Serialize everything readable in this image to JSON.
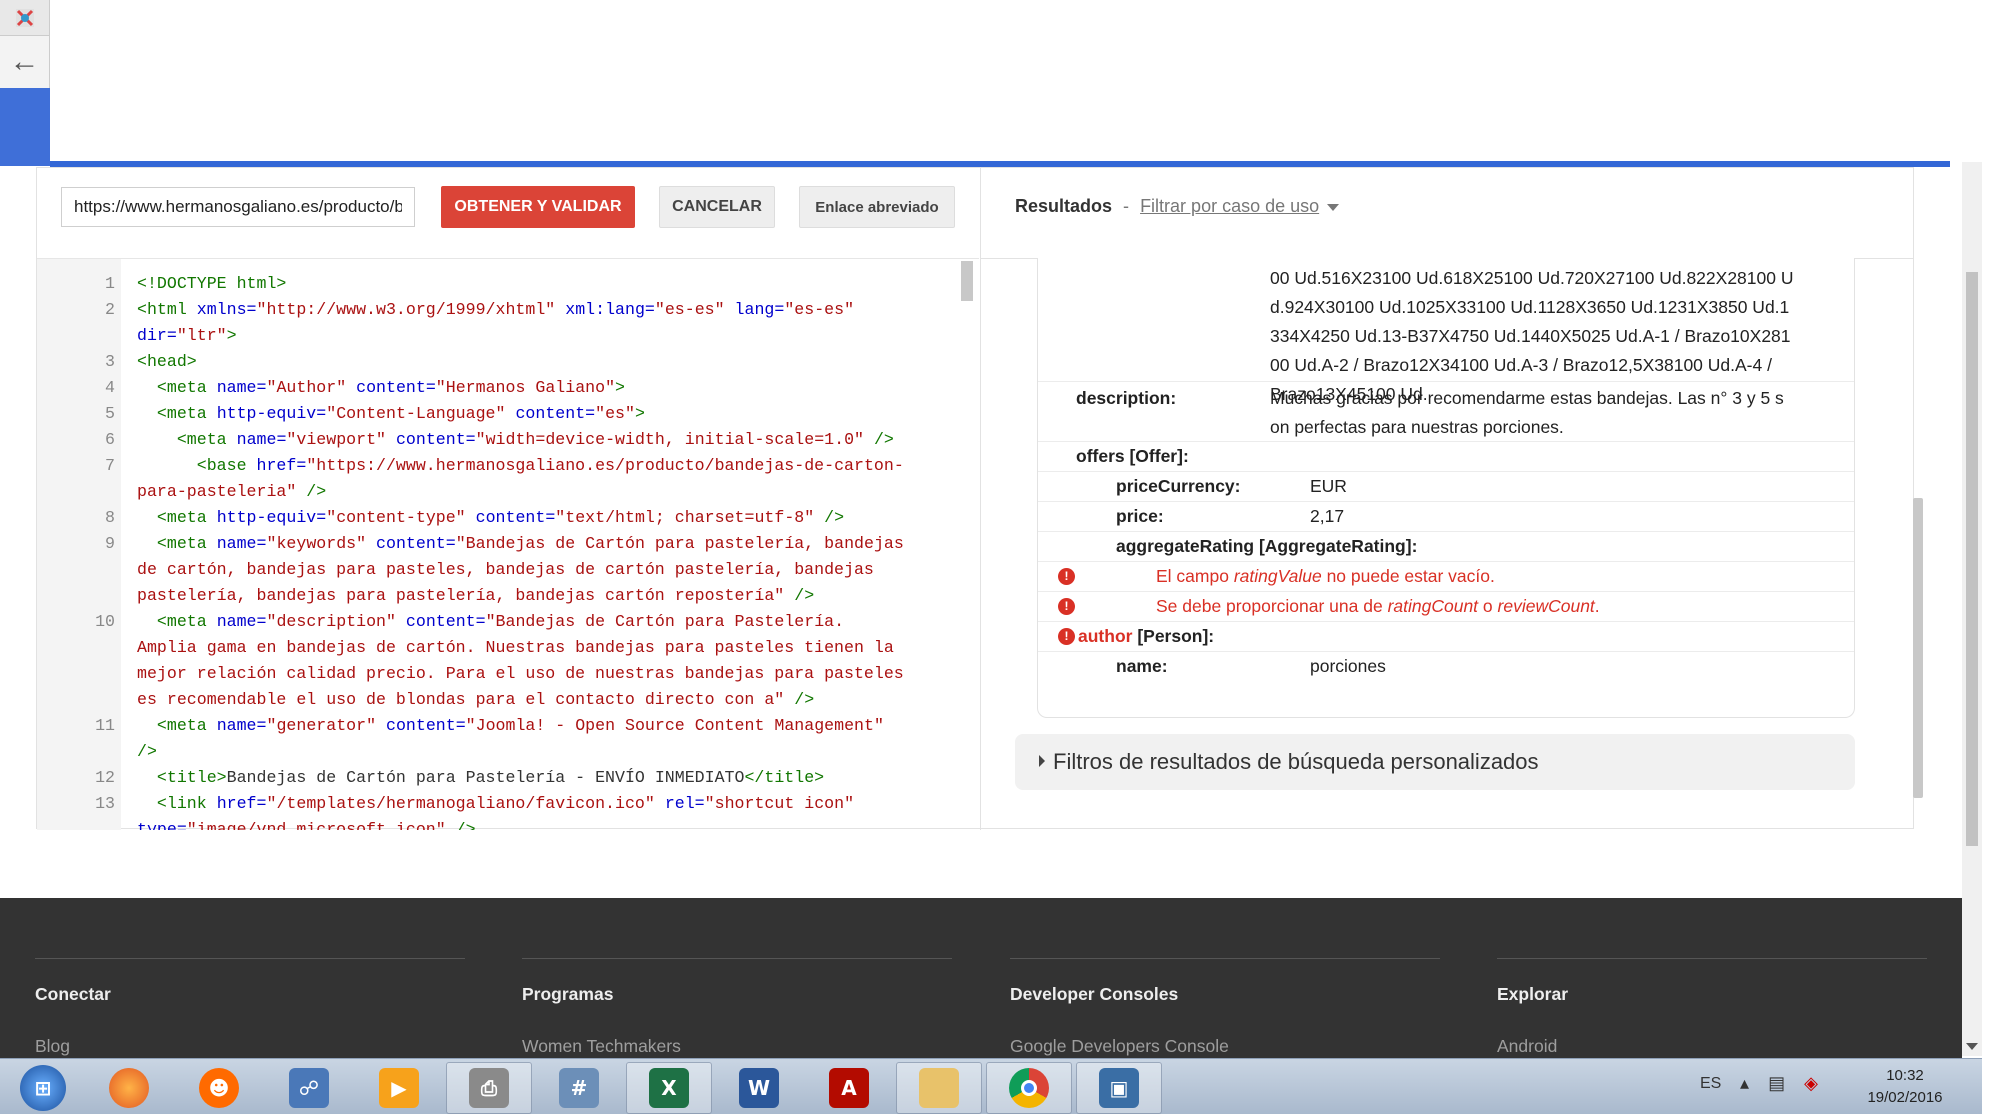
{
  "browser": {
    "back_icon": "arrow-left-icon"
  },
  "toolbar": {
    "url_value": "https://www.hermanosgaliano.es/producto/bandejas-de-carton-para-pasteleria",
    "fetch_label": "OBTENER Y VALIDAR",
    "cancel_label": "CANCELAR",
    "shortlink_label": "Enlace abreviado"
  },
  "editor": {
    "lines": [
      {
        "n": "1",
        "html": "<span class=\"tag\">&lt;!DOCTYPE html&gt;</span>"
      },
      {
        "n": "2",
        "html": "<span class=\"tag\">&lt;html</span> <span class=\"att\">xmlns=</span><span class=\"str\">\"http://www.w3.org/1999/xhtml\"</span> <span class=\"att\">xml:lang=</span><span class=\"str\">\"es-es\"</span> <span class=\"att\">lang=</span><span class=\"str\">\"es-es\"</span>"
      },
      {
        "n": "",
        "html": "<span class=\"att\">dir=</span><span class=\"str\">\"ltr\"</span><span class=\"tag\">&gt;</span>"
      },
      {
        "n": "3",
        "html": "<span class=\"tag\">&lt;head&gt;</span>"
      },
      {
        "n": "4",
        "html": "  <span class=\"tag\">&lt;meta</span> <span class=\"att\">name=</span><span class=\"str\">\"Author\"</span> <span class=\"att\">content=</span><span class=\"str\">\"Hermanos Galiano\"</span><span class=\"tag\">&gt;</span>"
      },
      {
        "n": "5",
        "html": "  <span class=\"tag\">&lt;meta</span> <span class=\"att\">http-equiv=</span><span class=\"str\">\"Content-Language\"</span> <span class=\"att\">content=</span><span class=\"str\">\"es\"</span><span class=\"tag\">&gt;</span>"
      },
      {
        "n": "6",
        "html": "    <span class=\"tag\">&lt;meta</span> <span class=\"att\">name=</span><span class=\"str\">\"viewport\"</span> <span class=\"att\">content=</span><span class=\"str\">\"width=device-width, initial-scale=1.0\"</span> <span class=\"tag\">/&gt;</span>"
      },
      {
        "n": "7",
        "html": "      <span class=\"tag\">&lt;base</span> <span class=\"att\">href=</span><span class=\"str\">\"https://www.hermanosgaliano.es/producto/bandejas-de-carton-</span>"
      },
      {
        "n": "",
        "html": "<span class=\"str\">para-pasteleria\"</span> <span class=\"tag\">/&gt;</span>"
      },
      {
        "n": "8",
        "html": "  <span class=\"tag\">&lt;meta</span> <span class=\"att\">http-equiv=</span><span class=\"str\">\"content-type\"</span> <span class=\"att\">content=</span><span class=\"str\">\"text/html; charset=utf-8\"</span> <span class=\"tag\">/&gt;</span>"
      },
      {
        "n": "9",
        "html": "  <span class=\"tag\">&lt;meta</span> <span class=\"att\">name=</span><span class=\"str\">\"keywords\"</span> <span class=\"att\">content=</span><span class=\"str\">\"Bandejas de Cartón para pastelería, bandejas</span>"
      },
      {
        "n": "",
        "html": "<span class=\"str\">de cartón, bandejas para pasteles, bandejas de cartón pastelería, bandejas</span>"
      },
      {
        "n": "",
        "html": "<span class=\"str\">pastelería, bandejas para pastelería, bandejas cartón repostería\"</span> <span class=\"tag\">/&gt;</span>"
      },
      {
        "n": "10",
        "html": "  <span class=\"tag\">&lt;meta</span> <span class=\"att\">name=</span><span class=\"str\">\"description\"</span> <span class=\"att\">content=</span><span class=\"str\">\"Bandejas de Cartón para Pastelería.</span>"
      },
      {
        "n": "",
        "html": "<span class=\"str\">Amplia gama en bandejas de cartón. Nuestras bandejas para pasteles tienen la</span>"
      },
      {
        "n": "",
        "html": "<span class=\"str\">mejor relación calidad precio. Para el uso de nuestras bandejas para pasteles</span>"
      },
      {
        "n": "",
        "html": "<span class=\"str\">es recomendable el uso de blondas para el contacto directo con a\"</span> <span class=\"tag\">/&gt;</span>"
      },
      {
        "n": "11",
        "html": "  <span class=\"tag\">&lt;meta</span> <span class=\"att\">name=</span><span class=\"str\">\"generator\"</span> <span class=\"att\">content=</span><span class=\"str\">\"Joomla! - Open Source Content Management\"</span>"
      },
      {
        "n": "",
        "html": "<span class=\"tag\">/&gt;</span>"
      },
      {
        "n": "12",
        "html": "  <span class=\"tag\">&lt;title&gt;</span>Bandejas de Cartón para Pastelería - ENVÍO INMEDIATO<span class=\"tag\">&lt;/title&gt;</span>"
      },
      {
        "n": "13",
        "html": "  <span class=\"tag\">&lt;link</span> <span class=\"att\">href=</span><span class=\"str\">\"/templates/hermanogaliano/favicon.ico\"</span> <span class=\"att\">rel=</span><span class=\"str\">\"shortcut icon\"</span>"
      },
      {
        "n": "",
        "html": "<span class=\"att\">type=</span><span class=\"str\">\"image/vnd.microsoft.icon\"</span> <span class=\"tag\">/&gt;</span>"
      }
    ]
  },
  "results": {
    "title": "Resultados",
    "separator": "-",
    "filter_label": "Filtrar por caso de uso",
    "name_lines": [
      "00 Ud.516X23100 Ud.618X25100 Ud.720X27100 Ud.822X28100 U",
      "d.924X30100 Ud.1025X33100 Ud.1128X3650 Ud.1231X3850 Ud.1",
      "334X4250 Ud.13-B37X4750 Ud.1440X5025 Ud.A-1 / Brazo10X281",
      "00 Ud.A-2 / Brazo12X34100 Ud.A-3 / Brazo12,5X38100 Ud.A-4 /",
      "Brazo13X45100 Ud."
    ],
    "description_key": "description:",
    "description_lines": [
      "Muchas gracias por recomendarme estas bandejas. Las n° 3 y 5 s",
      "on perfectas para nuestras porciones."
    ],
    "offers_key": "offers [Offer]:",
    "price_currency_key": "priceCurrency:",
    "price_currency_value": "EUR",
    "price_key": "price:",
    "price_value": "2,17",
    "aggregate_key": "aggregateRating [AggregateRating]:",
    "error1_pre": "El campo ",
    "error1_field": "ratingValue",
    "error1_post": " no puede estar vacío.",
    "error2_pre": "Se debe proporcionar una de ",
    "error2_field1": "ratingCount",
    "error2_mid": " o ",
    "error2_field2": "reviewCount",
    "error2_post": ".",
    "author_key": "author",
    "author_type": " [Person]:",
    "author_name_key": "name:",
    "author_name_value": "porciones",
    "filters_bar_label": "Filtros de resultados de búsqueda personalizados"
  },
  "footer": {
    "columns": [
      {
        "heading": "Conectar",
        "link": "Blog"
      },
      {
        "heading": "Programas",
        "link": "Women Techmakers"
      },
      {
        "heading": "Developer Consoles",
        "link": "Google Developers Console"
      },
      {
        "heading": "Explorar",
        "link": "Android"
      }
    ]
  },
  "taskbar": {
    "apps": [
      "start-orb-icon",
      "firefox-icon",
      "smiley-icon",
      "network-icon",
      "media-player-icon",
      "printer-icon",
      "calculator-icon",
      "excel-icon",
      "word-icon",
      "acrobat-icon",
      "explorer-folder-icon",
      "chrome-icon",
      "remote-desktop-icon"
    ],
    "language": "ES",
    "time": "10:32",
    "date": "19/02/2016"
  }
}
